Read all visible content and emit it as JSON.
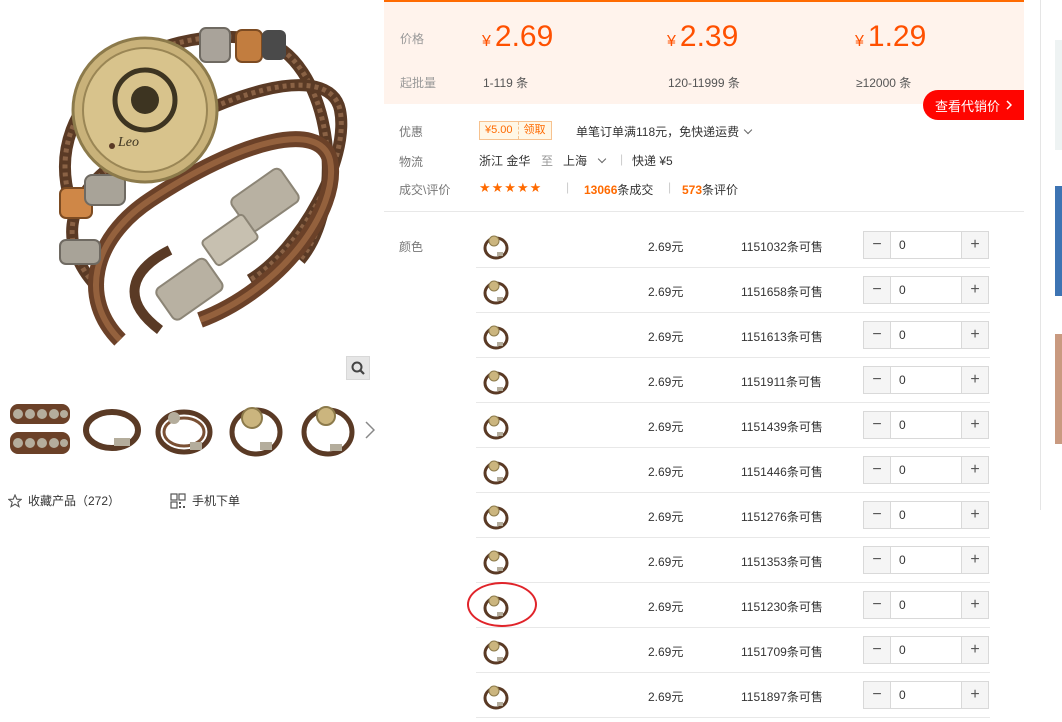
{
  "gallery": {
    "favorite_label": "收藏产品（272）",
    "mobile_label": "手机下单",
    "main_image_alt": "bracelet-leo",
    "icons": {
      "zoom": "search-icon",
      "next": "chevron-right-icon",
      "favorite": "star-outline-icon",
      "mobile": "qr-code-icon"
    }
  },
  "price_band": {
    "price_label": "价格",
    "moq_label": "起批量",
    "currency": "¥",
    "tiers": [
      {
        "price": "2.69",
        "moq": "1-119 条"
      },
      {
        "price": "2.39",
        "moq": "120-11999 条"
      },
      {
        "price": "1.29",
        "moq": "≥12000 条"
      }
    ],
    "agent_button": "查看代销价",
    "accent": "#ff5000"
  },
  "info": {
    "discount_label": "优惠",
    "coupon_amount": "¥5.00",
    "coupon_action": "领取",
    "discount_text": "单笔订单满118元，免快递运费",
    "logistics_label": "物流",
    "origin": "浙江 金华",
    "to_word": "至",
    "destination": "上海",
    "shipping": "快递 ¥5",
    "deals_label": "成交\\评价",
    "stars": "★★★★★",
    "stars_rating": 5,
    "deals_count": "13066",
    "deals_suffix": "条成交",
    "reviews_count": "573",
    "reviews_suffix": "条评价"
  },
  "variants": {
    "label": "颜色",
    "rows": [
      {
        "price": "2.69元",
        "stock": "1151032条可售",
        "qty": "0"
      },
      {
        "price": "2.69元",
        "stock": "1151658条可售",
        "qty": "0"
      },
      {
        "price": "2.69元",
        "stock": "1151613条可售",
        "qty": "0"
      },
      {
        "price": "2.69元",
        "stock": "1151911条可售",
        "qty": "0"
      },
      {
        "price": "2.69元",
        "stock": "1151439条可售",
        "qty": "0"
      },
      {
        "price": "2.69元",
        "stock": "1151446条可售",
        "qty": "0"
      },
      {
        "price": "2.69元",
        "stock": "1151276条可售",
        "qty": "0"
      },
      {
        "price": "2.69元",
        "stock": "1151353条可售",
        "qty": "0"
      },
      {
        "price": "2.69元",
        "stock": "1151230条可售",
        "qty": "0"
      },
      {
        "price": "2.69元",
        "stock": "1151709条可售",
        "qty": "0"
      },
      {
        "price": "2.69元",
        "stock": "1151897条可售",
        "qty": "0"
      }
    ],
    "minus_symbol": "−",
    "plus_symbol": "+",
    "highlight_row_index": 8,
    "highlight_color": "#e0242a"
  }
}
